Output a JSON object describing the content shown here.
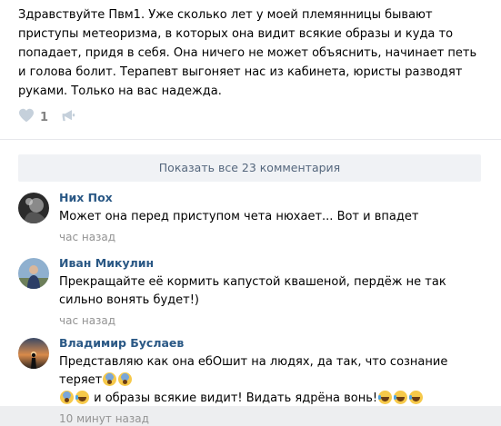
{
  "post": {
    "text": "Здравствуйте Пвм1. Уже сколько лет у моей племянницы бывают приступы метеоризма, в которых она видит всякие образы и куда то попадает, придя в себя. Она ничего не может объяснить, начинает петь и голова болит. Терапевт выгоняет нас из кабинета, юристы разводят руками. Только на вас надежда.",
    "like_count": "1"
  },
  "comments_block": {
    "show_all_label": "Показать все 23 комментария"
  },
  "comments": [
    {
      "author": "Них Пох",
      "text": "Может она перед приступом чета нюхает... Вот и впадет",
      "date": "час назад"
    },
    {
      "author": "Иван Микулин",
      "text": "Прекращайте её кормить капустой квашеной, пердёж не так сильно вонять будет!)",
      "date": "час назад"
    },
    {
      "author": "Владимир Буслаев",
      "text_part1": "Представляю как она ебОшит на людях, да так, что сознание теряет",
      "text_part2": " и образы всякие видит! Видать ядрёна вонь!",
      "date": "10 минут назад"
    }
  ],
  "icons": {
    "like": "heart-icon",
    "share": "megaphone-icon"
  },
  "colors": {
    "link": "#2a5885",
    "muted": "#939393",
    "button_bg": "#f0f2f5",
    "button_text": "#55677d"
  }
}
